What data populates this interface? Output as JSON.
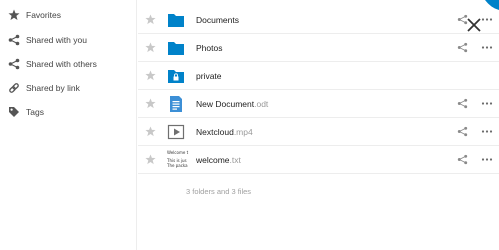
{
  "sidebar": {
    "items": [
      {
        "label": "Favorites",
        "icon": "star-icon"
      },
      {
        "label": "Shared with you",
        "icon": "share-icon"
      },
      {
        "label": "Shared with others",
        "icon": "share-icon"
      },
      {
        "label": "Shared by link",
        "icon": "link-icon"
      },
      {
        "label": "Tags",
        "icon": "tag-icon"
      }
    ]
  },
  "files": [
    {
      "name": "Documents",
      "ext": "",
      "type": "folder"
    },
    {
      "name": "Photos",
      "ext": "",
      "type": "folder"
    },
    {
      "name": "private",
      "ext": "",
      "type": "folder-locked"
    },
    {
      "name": "New Document",
      "ext": ".odt",
      "type": "document"
    },
    {
      "name": "Nextcloud",
      "ext": ".mp4",
      "type": "video"
    },
    {
      "name": "welcome",
      "ext": ".txt",
      "type": "text"
    }
  ],
  "txt_preview": [
    "Welcome t",
    "This is jus",
    "The packa"
  ],
  "summary": "3 folders and 3 files",
  "colors": {
    "folder": "#0082c9",
    "icon_gray": "#969696",
    "accent": "#0082c9"
  }
}
